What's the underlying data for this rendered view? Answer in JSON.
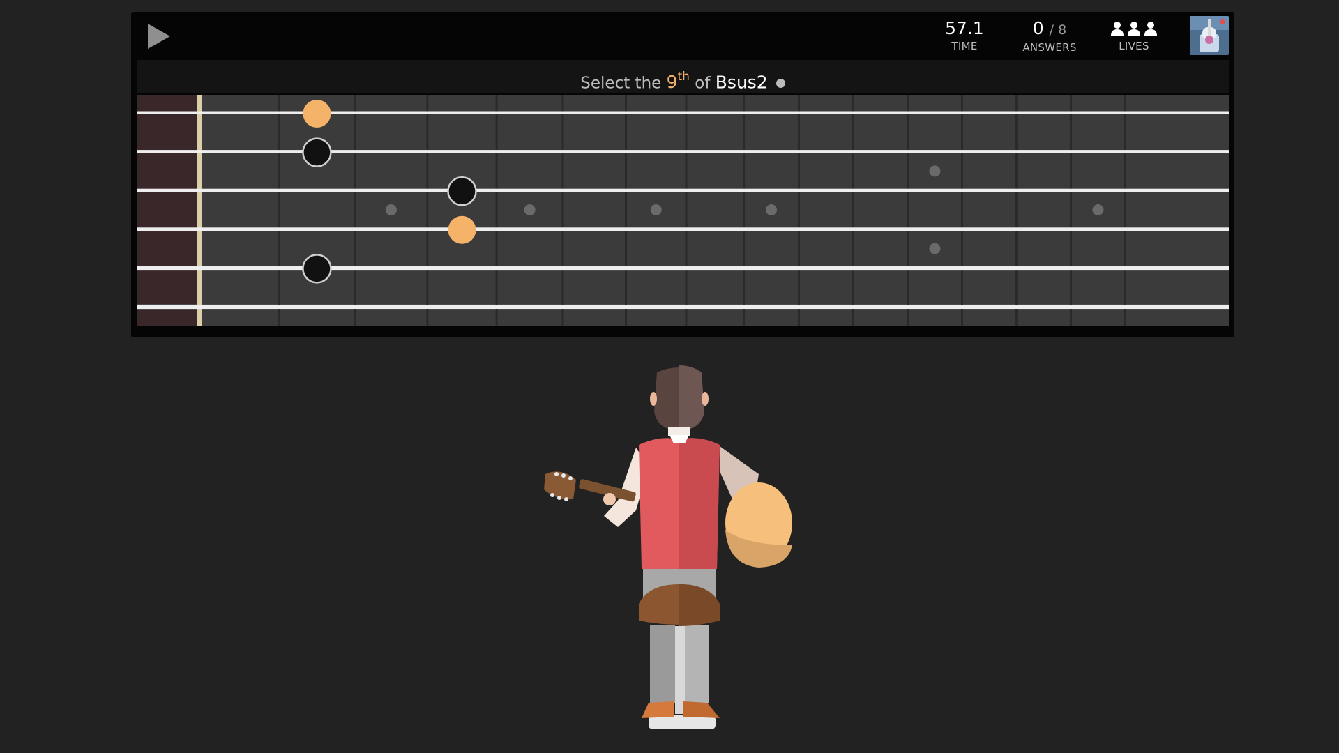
{
  "header": {
    "time_value": "57.1",
    "time_label": "TIME",
    "answers_value": "0",
    "answers_total": "/ 8",
    "answers_label": "ANSWERS",
    "lives_label": "LIVES",
    "lives_count": 3
  },
  "prompt": {
    "prefix": "Select the",
    "interval_number": "9",
    "interval_suffix": "th",
    "middle": "of",
    "chord": "Bsus2"
  },
  "fretboard": {
    "strings": 6,
    "frets": 15,
    "fret_markers": [
      {
        "fret": 3,
        "type": "single"
      },
      {
        "fret": 5,
        "type": "single"
      },
      {
        "fret": 7,
        "type": "single"
      },
      {
        "fret": 9,
        "type": "single"
      },
      {
        "fret": 12,
        "type": "double"
      },
      {
        "fret": 15,
        "type": "single"
      }
    ],
    "notes": [
      {
        "string": 1,
        "fret": 2,
        "state": "selected"
      },
      {
        "string": 2,
        "fret": 2,
        "state": "outline"
      },
      {
        "string": 3,
        "fret": 4,
        "state": "outline"
      },
      {
        "string": 4,
        "fret": 4,
        "state": "selected"
      },
      {
        "string": 5,
        "fret": 2,
        "state": "outline"
      }
    ]
  },
  "colors": {
    "accent": "#f5b36a",
    "background": "#222222",
    "panel": "#050505",
    "fretboard_wood": "#3d3d3d",
    "nut": "#d9cfa8"
  },
  "icons": {
    "play": "play-icon",
    "lives": "user-icon",
    "audio": "dot-icon"
  }
}
